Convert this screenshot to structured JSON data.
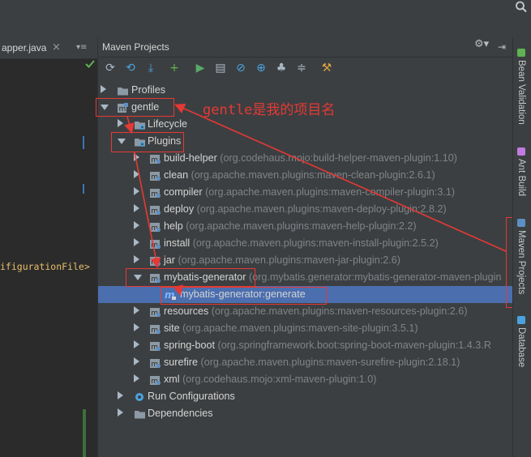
{
  "editor": {
    "tab_file": "apper.java",
    "tab_close": "×",
    "tab_menu": "▾≡",
    "code_line": "ifigurationFile>"
  },
  "maven_panel": {
    "title": "Maven Projects",
    "gear": "⚙▾",
    "hide": "⇥",
    "toolbar": [
      {
        "icon": "refresh-icon",
        "glyph": "⟳",
        "color": "#a9b7c6"
      },
      {
        "icon": "generate-sources-icon",
        "glyph": "⟲",
        "color": "#4aa3df"
      },
      {
        "icon": "download-icon",
        "glyph": "⤓",
        "color": "#4aa3df"
      },
      {
        "icon": "add-icon",
        "glyph": "+",
        "color": "#5fb352"
      },
      {
        "icon": "run-icon",
        "glyph": "▶",
        "color": "#59a869"
      },
      {
        "icon": "execute-goal-icon",
        "glyph": "▤",
        "color": "#a9b7c6"
      },
      {
        "icon": "toggle-offline-icon",
        "glyph": "⊘",
        "color": "#4aa3df"
      },
      {
        "icon": "skip-tests-icon",
        "glyph": "⊕",
        "color": "#4aa3df"
      },
      {
        "icon": "show-dependencies-icon",
        "glyph": "♣",
        "color": "#a9b7c6"
      },
      {
        "icon": "collapse-all-icon",
        "glyph": "≑",
        "color": "#a9b7c6"
      },
      {
        "icon": "settings-icon",
        "glyph": "⚒",
        "color": "#d9a343"
      }
    ],
    "tree": [
      {
        "name": "Profiles",
        "desc": "",
        "icon": "folder",
        "arrow": "right",
        "indent": 0
      },
      {
        "name": "gentle",
        "desc": "",
        "icon": "maven",
        "arrow": "down",
        "indent": 0
      },
      {
        "name": "Lifecycle",
        "desc": "",
        "icon": "folder-gear",
        "arrow": "right",
        "indent": 1
      },
      {
        "name": "Plugins",
        "desc": "",
        "icon": "folder-gear",
        "arrow": "down",
        "indent": 1
      },
      {
        "name": "build-helper",
        "desc": "(org.codehaus.mojo:build-helper-maven-plugin:1.10)",
        "icon": "plugin",
        "arrow": "right",
        "indent": 2
      },
      {
        "name": "clean",
        "desc": "(org.apache.maven.plugins:maven-clean-plugin:2.6.1)",
        "icon": "plugin",
        "arrow": "right",
        "indent": 2
      },
      {
        "name": "compiler",
        "desc": "(org.apache.maven.plugins:maven-compiler-plugin:3.1)",
        "icon": "plugin",
        "arrow": "right",
        "indent": 2
      },
      {
        "name": "deploy",
        "desc": "(org.apache.maven.plugins:maven-deploy-plugin:2.8.2)",
        "icon": "plugin",
        "arrow": "right",
        "indent": 2
      },
      {
        "name": "help",
        "desc": "(org.apache.maven.plugins:maven-help-plugin:2.2)",
        "icon": "plugin",
        "arrow": "right",
        "indent": 2
      },
      {
        "name": "install",
        "desc": "(org.apache.maven.plugins:maven-install-plugin:2.5.2)",
        "icon": "plugin",
        "arrow": "right",
        "indent": 2
      },
      {
        "name": "jar",
        "desc": "(org.apache.maven.plugins:maven-jar-plugin:2.6)",
        "icon": "plugin",
        "arrow": "right",
        "indent": 2
      },
      {
        "name": "mybatis-generator",
        "desc": "(org.mybatis.generator:mybatis-generator-maven-plugin",
        "icon": "plugin",
        "arrow": "down",
        "indent": 2
      },
      {
        "name": "mybatis-generator:generate",
        "desc": "",
        "icon": "goal",
        "arrow": "none",
        "indent": 3,
        "selected": true
      },
      {
        "name": "resources",
        "desc": "(org.apache.maven.plugins:maven-resources-plugin:2.6)",
        "icon": "plugin",
        "arrow": "right",
        "indent": 2
      },
      {
        "name": "site",
        "desc": "(org.apache.maven.plugins:maven-site-plugin:3.5.1)",
        "icon": "plugin",
        "arrow": "right",
        "indent": 2
      },
      {
        "name": "spring-boot",
        "desc": "(org.springframework.boot:spring-boot-maven-plugin:1.4.3.R",
        "icon": "plugin",
        "arrow": "right",
        "indent": 2
      },
      {
        "name": "surefire",
        "desc": "(org.apache.maven.plugins:maven-surefire-plugin:2.18.1)",
        "icon": "plugin",
        "arrow": "right",
        "indent": 2
      },
      {
        "name": "xml",
        "desc": "(org.codehaus.mojo:xml-maven-plugin:1.0)",
        "icon": "plugin",
        "arrow": "right",
        "indent": 2
      },
      {
        "name": "Run Configurations",
        "desc": "",
        "icon": "run-config",
        "arrow": "right",
        "indent": 1
      },
      {
        "name": "Dependencies",
        "desc": "",
        "icon": "folder",
        "arrow": "right",
        "indent": 1
      }
    ]
  },
  "annotation": {
    "note": "gentle是我的项目名",
    "color": "#e53935"
  },
  "right_stripe": {
    "tabs": [
      "Bean Validation",
      "Ant Build",
      "Maven Projects",
      "Database"
    ]
  }
}
